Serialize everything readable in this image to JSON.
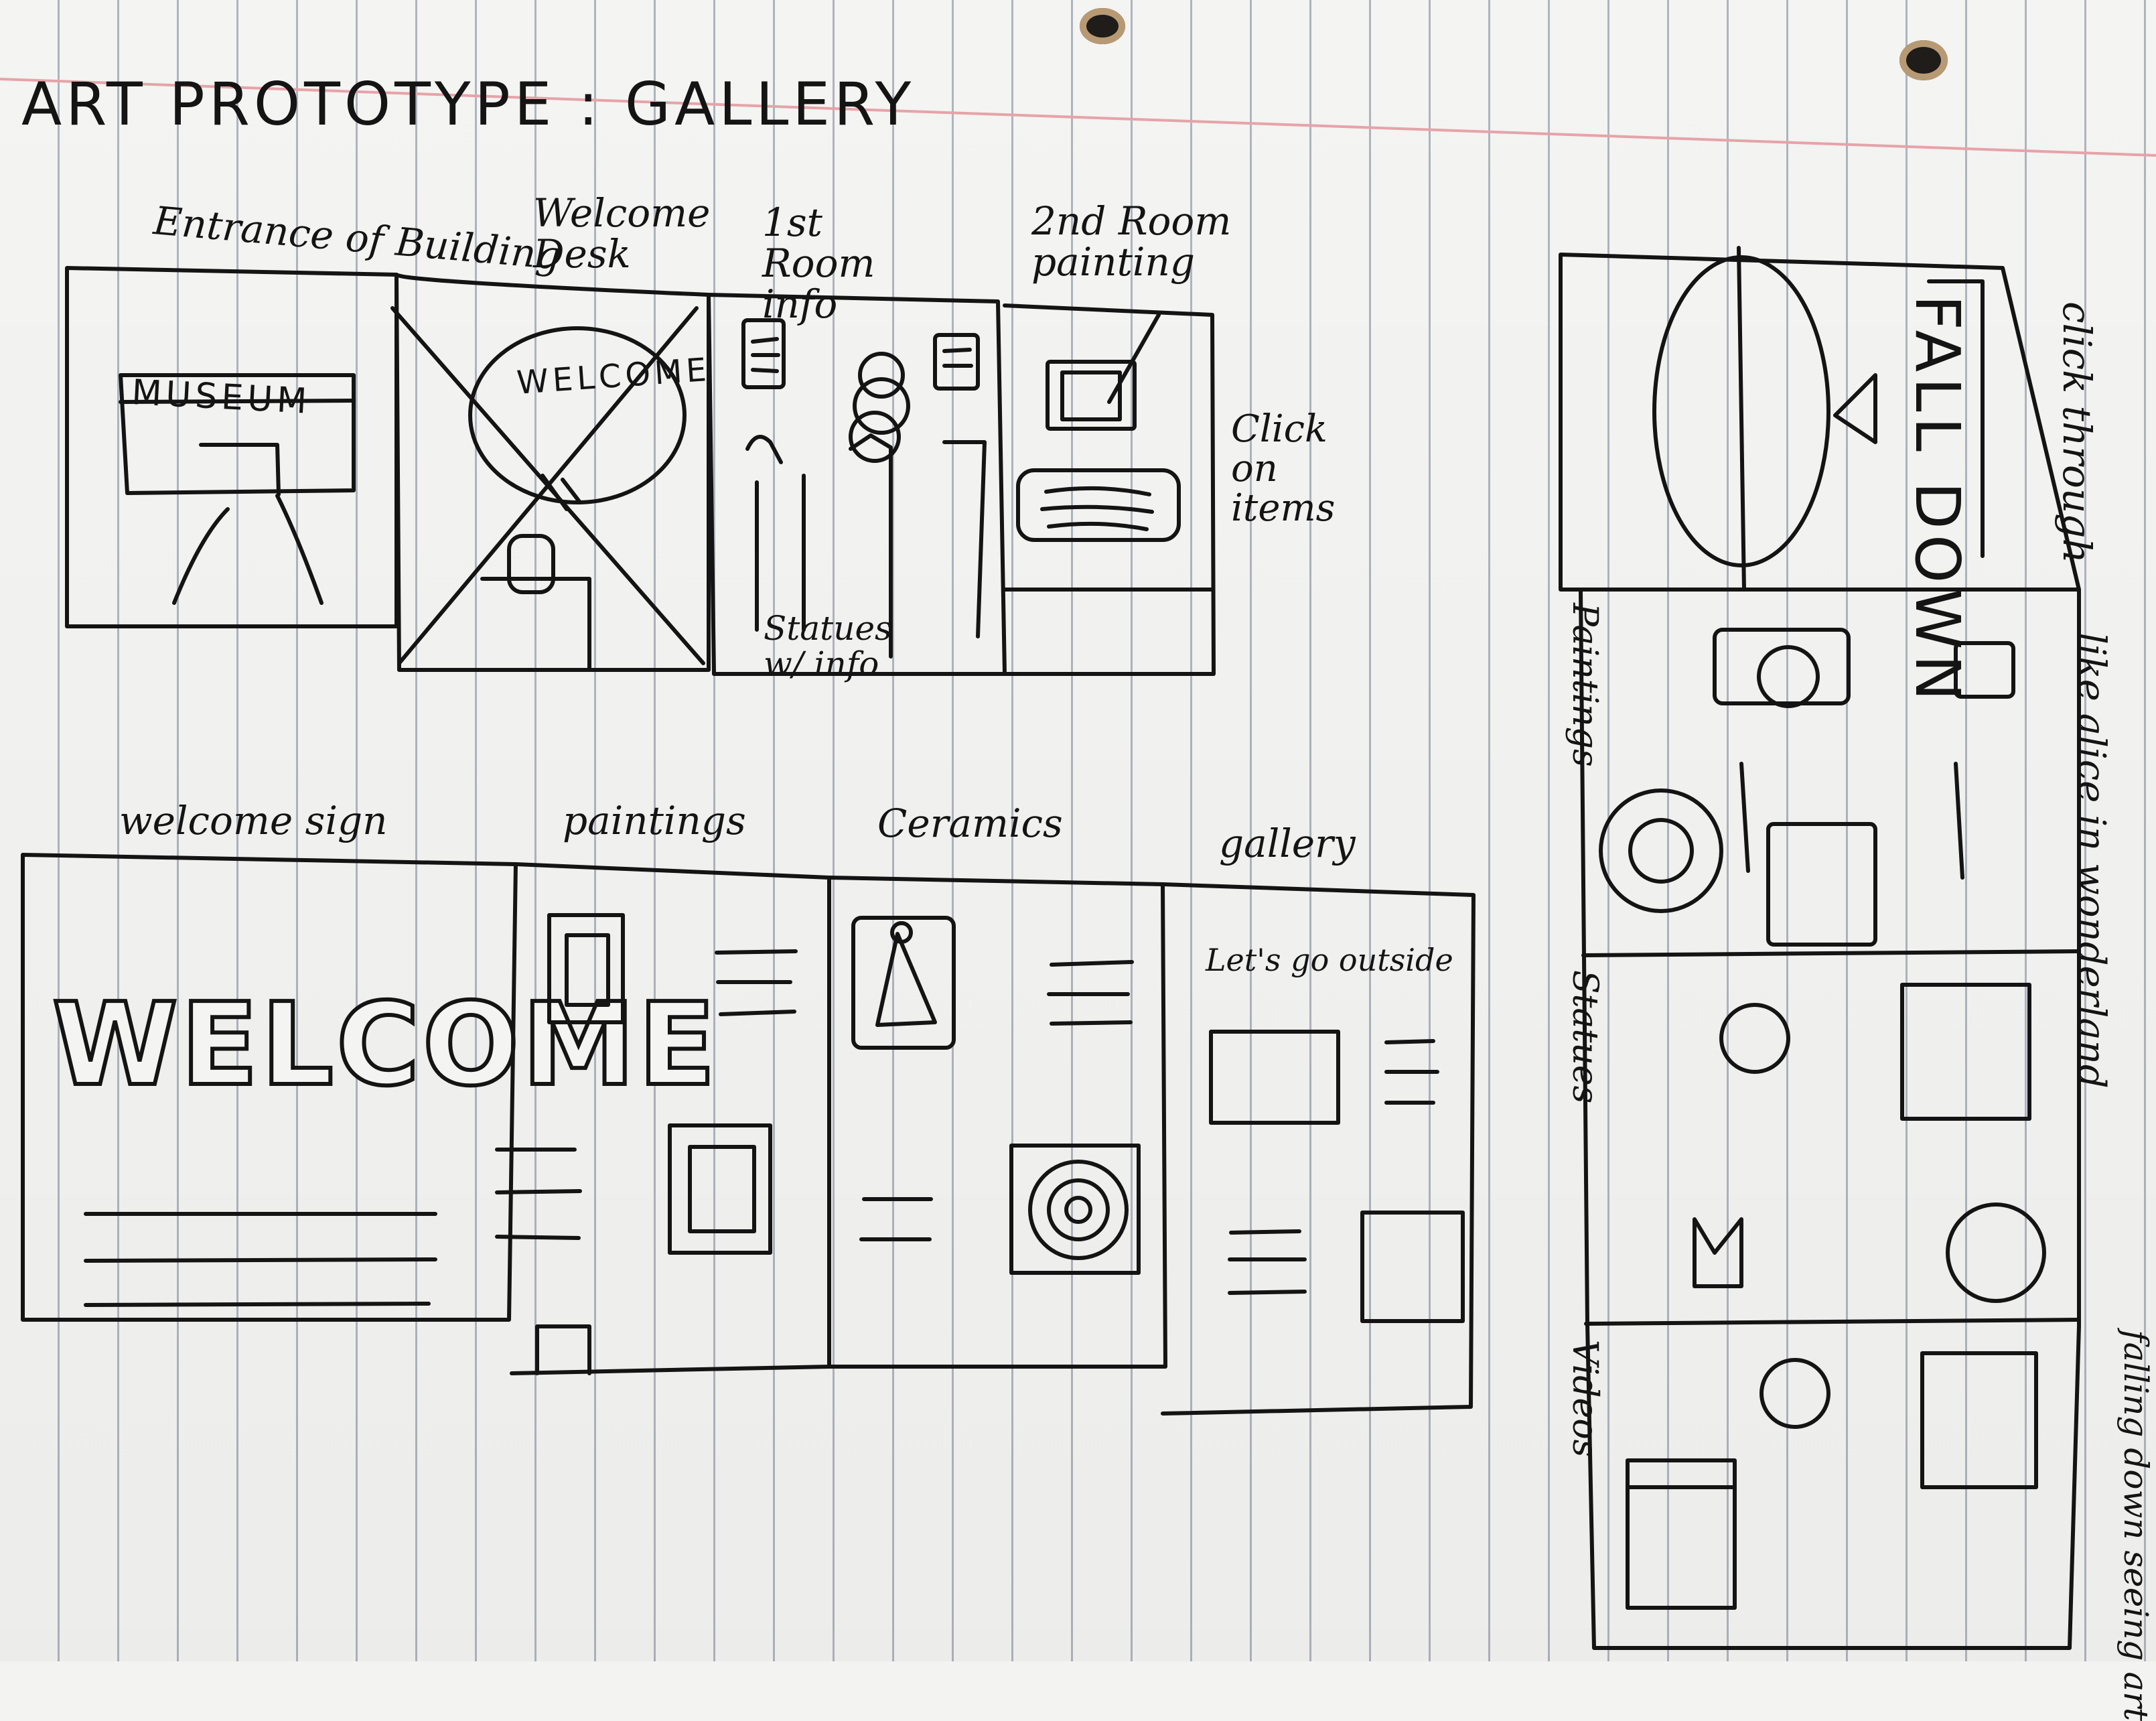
{
  "title": "ART PROTOTYPE : GALLERY",
  "top_row": {
    "entrance_label": "Entrance of Building",
    "museum_sign": "MUSEUM",
    "welcome_desk_label": "Welcome Desk",
    "welcome_banner": "WELCOME",
    "first_room_label": "1st Room info",
    "statues_note": "Statues w/ info",
    "second_room_label": "2nd Room painting",
    "click_note": "Click on items"
  },
  "bottom_row": {
    "welcome_sign_label": "welcome sign",
    "welcome_big": "WELCOME",
    "paintings_label": "paintings",
    "ceramics_label": "Ceramics",
    "gallery_label": "gallery",
    "gallery_caption": "Let's go outside"
  },
  "right_column": {
    "fall_down": "FALL DOWN",
    "click_through": "click through",
    "alice_note": "like alice in wonderland",
    "paintings_label": "Paintings",
    "statues_label": "Statues",
    "videos_label": "Videos",
    "falling_note": "falling down seeing art"
  }
}
